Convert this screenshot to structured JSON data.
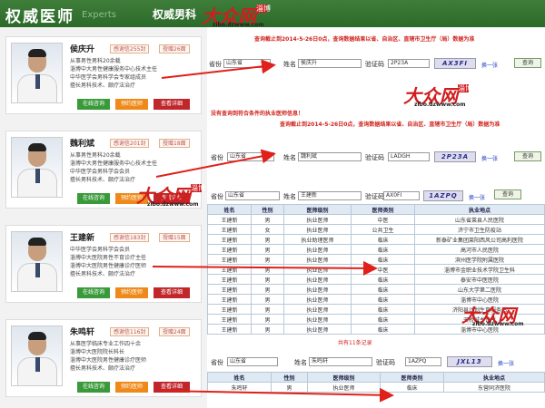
{
  "header": {
    "title": "权威医师",
    "subtitle_en": "Experts",
    "title2": "权威男科"
  },
  "logo": {
    "brand": "大众网",
    "city": "淄博",
    "url": "zibo.dzwww.com"
  },
  "doctors": [
    {
      "name": "侯庆升",
      "thanks": "感谢信255封",
      "gifts": "授赠26面",
      "lines": [
        "从事男性男科20余载",
        "淄博中大男性健康服务中心技术主任",
        "中华医学会男科学会专家组成员",
        "擅长男科技术、颇疗法治疗"
      ],
      "btn_online": "在线咨询",
      "btn_appt": "预约医师",
      "btn_detail": "查看详细"
    },
    {
      "name": "魏利斌",
      "thanks": "感谢信201封",
      "gifts": "授赠18面",
      "lines": [
        "从事男性男科20余载",
        "淄博中大男性健康服务中心技术主任",
        "中华医学会男科学会会员",
        "擅长男科技术、颇疗法治疗"
      ],
      "btn_online": "在线咨询",
      "btn_appt": "预约医师",
      "btn_detail": "查看详细"
    },
    {
      "name": "王建新",
      "thanks": "感谢信183封",
      "gifts": "授赠15面",
      "lines": [
        "中华医学会男科学会会员",
        "淄博中大医院男性不育诊疗主任",
        "淄博中大医院男性健康诊疗医师",
        "擅长男科技术、颇疗法治疗"
      ],
      "btn_online": "在线咨询",
      "btn_appt": "预约医师",
      "btn_detail": "查看详细"
    },
    {
      "name": "朱鸣轩",
      "thanks": "感谢信116封",
      "gifts": "授赠24面",
      "lines": [
        "从事医学临床专业工作四十余",
        "淄博中大医院院长科长",
        "淄博中大医院男性健康诊疗医师",
        "擅长男科技术、颇疗法治疗"
      ],
      "btn_online": "在线咨询",
      "btn_appt": "预约医师",
      "btn_detail": "查看详细"
    }
  ],
  "query_note": "查询截止到2014-5-26日0点，查询数据结果以省、自治区、直辖市卫生厅（局）数据为准",
  "query_note_short": "查询截止到2014-5-26日0点，查询数据结果以省、自治区、直辖市卫生厅（局）数据为准",
  "no_result": "没有查询到符合条件的执业医师信息！",
  "panel1": {
    "prov_label": "省份",
    "prov": "山东省",
    "name_label": "姓名",
    "name": "侯庆升",
    "code_label": "验证码",
    "code": "2P23A",
    "captcha": "AX3FI",
    "refresh": "换一张",
    "query": "查询"
  },
  "panel2": {
    "prov_label": "省份",
    "prov": "山东省",
    "name_label": "姓名",
    "name": "魏利斌",
    "code_label": "验证码",
    "code": "LADGH",
    "captcha": "2P23A",
    "refresh": "换一张",
    "query": "查询"
  },
  "panel3": {
    "prov_label": "省份",
    "prov": "山东省",
    "name_label": "姓名",
    "name": "王建新",
    "code_label": "验证码",
    "code": "AX0FI",
    "captcha": "1AZPQ",
    "refresh": "换一张",
    "query": "查询",
    "headers": [
      "姓名",
      "性别",
      "医师级别",
      "医师类别",
      "执业地点"
    ],
    "rows": [
      [
        "王建新",
        "男",
        "执业医师",
        "中医",
        "山东省莱县人民医院"
      ],
      [
        "王建新",
        "女",
        "执业医师",
        "公共卫生",
        "济宁市卫生防疫站"
      ],
      [
        "王建新",
        "男",
        "执业助理医师",
        "临床",
        "新泰矿业集团莱阳西风公司高利医院"
      ],
      [
        "王建新",
        "男",
        "执业医师",
        "临床",
        "高河市人民医院"
      ],
      [
        "王建新",
        "男",
        "执业医师",
        "临床",
        "滨州医学院附属医院"
      ],
      [
        "王建新",
        "男",
        "执业医师",
        "中医",
        "淄博市金职业技术学院卫生科"
      ],
      [
        "王建新",
        "男",
        "执业医师",
        "临床",
        "泰安市中医医院"
      ],
      [
        "王建新",
        "男",
        "执业医师",
        "临床",
        "山东大学第二医院"
      ],
      [
        "王建新",
        "男",
        "执业医师",
        "临床",
        "淄博市中心医院"
      ],
      [
        "王建新",
        "男",
        "执业医师",
        "临床",
        "济阳县计划生育服务站"
      ],
      [
        "王建新",
        "男",
        "执业医师",
        "临床",
        "天桥城乡诊所"
      ],
      [
        "王建新",
        "男",
        "执业医师",
        "临床",
        "淄博市中心医院"
      ]
    ],
    "count": "共有11条记录"
  },
  "panel4": {
    "prov_label": "省份",
    "prov": "山东省",
    "name_label": "姓名",
    "name": "朱鸣轩",
    "code_label": "验证码",
    "code": "1AZPQ",
    "captcha": "JXL13",
    "refresh": "换一张",
    "query": "查询",
    "headers": [
      "姓名",
      "性别",
      "医师级别",
      "医师类别",
      "执业地点"
    ],
    "rows": [
      [
        "朱鸣轩",
        "男",
        "执业医师",
        "临床",
        "东营同济医院"
      ]
    ]
  },
  "colors": {
    "header_green": "#2c6a2a",
    "brand_red": "#d01e1e",
    "btn_green": "#3a9a3a",
    "btn_orange": "#ef8a1a",
    "btn_red": "#c0262a"
  }
}
